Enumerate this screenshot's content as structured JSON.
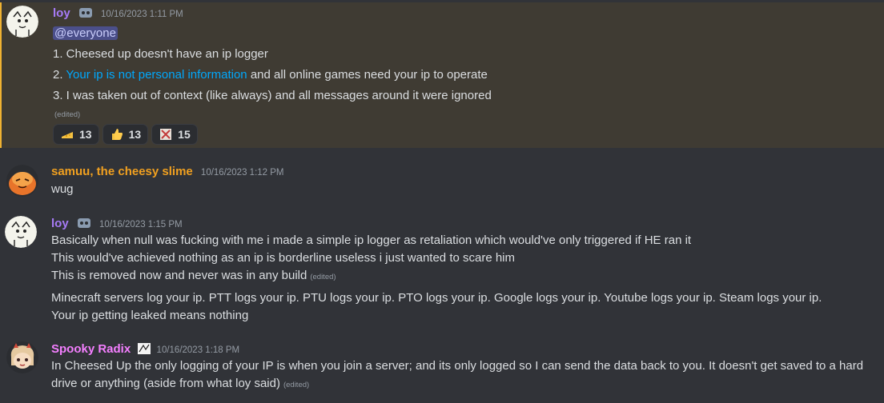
{
  "messages": [
    {
      "author": "loy",
      "author_color": "#a77bf7",
      "timestamp": "10/16/2023 1:11 PM",
      "mention": "@everyone",
      "lines": [
        "1. Cheesed up doesn't have an ip logger",
        "and all online games need your ip to operate",
        "3. I was taken out of context (like always) and all messages around it were ignored"
      ],
      "line2_prefix": "2. ",
      "line2_link": "Your ip is not personal information",
      "edited": "(edited)",
      "reactions": [
        {
          "icon": "cheese-icon",
          "count": "13"
        },
        {
          "icon": "thumbs-up-icon",
          "count": "13"
        },
        {
          "icon": "custom-emoji-icon",
          "count": "15"
        }
      ]
    },
    {
      "author": "samuu, the cheesy slime",
      "author_color": "#f0a020",
      "timestamp": "10/16/2023 1:12 PM",
      "lines": [
        "wug"
      ]
    },
    {
      "author": "loy",
      "author_color": "#a77bf7",
      "timestamp": "10/16/2023 1:15 PM",
      "lines": [
        "Basically when null was fucking with me i made a simple ip logger as retaliation which would've only triggered if HE ran it",
        "This would've achieved nothing as an ip is borderline useless i just wanted to scare him",
        "This is removed now and never was in any build",
        "Minecraft servers log your ip. PTT logs your ip. PTU logs your ip. PTO logs your ip. Google logs your ip. Youtube logs your ip. Steam logs your ip.",
        "Your ip getting leaked means nothing"
      ],
      "edited": "(edited)"
    },
    {
      "author": "Spooky Radix",
      "author_color": "#f47fff",
      "timestamp": "10/16/2023 1:18 PM",
      "lines": [
        "In Cheesed Up the only logging of your IP is when you join a server; and its only logged so I can send the data back to you. It doesn't get saved to a hard",
        "drive or anything (aside from what loy said)"
      ],
      "edited": "(edited)"
    }
  ]
}
